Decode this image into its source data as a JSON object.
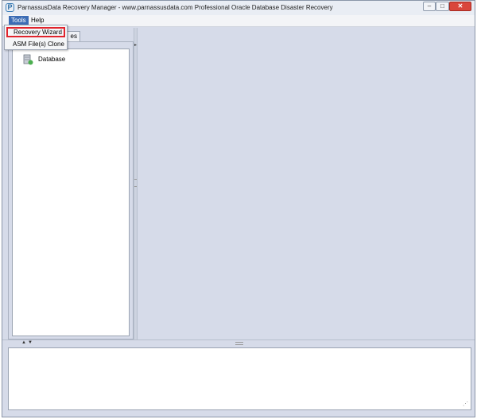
{
  "window": {
    "title": "ParnassusData Recovery Manager - www.parnassusdata.com  Professional Oracle Database Disaster Recovery",
    "logo_letter": "P",
    "controls": {
      "minimize": "–",
      "maximize": "□",
      "close": "✕"
    }
  },
  "menubar": {
    "items": [
      "Tools",
      "Help"
    ]
  },
  "tools_menu": {
    "items": [
      "Recovery Wizard",
      "ASM File(s) Clone"
    ],
    "highlight_color": "#e0242c"
  },
  "left_panel": {
    "tab_label": "es",
    "tree": [
      {
        "label": "Database",
        "icon": "database-icon"
      }
    ]
  },
  "colors": {
    "background": "#d6dbe9",
    "menu_selected": "#3d6db5"
  }
}
